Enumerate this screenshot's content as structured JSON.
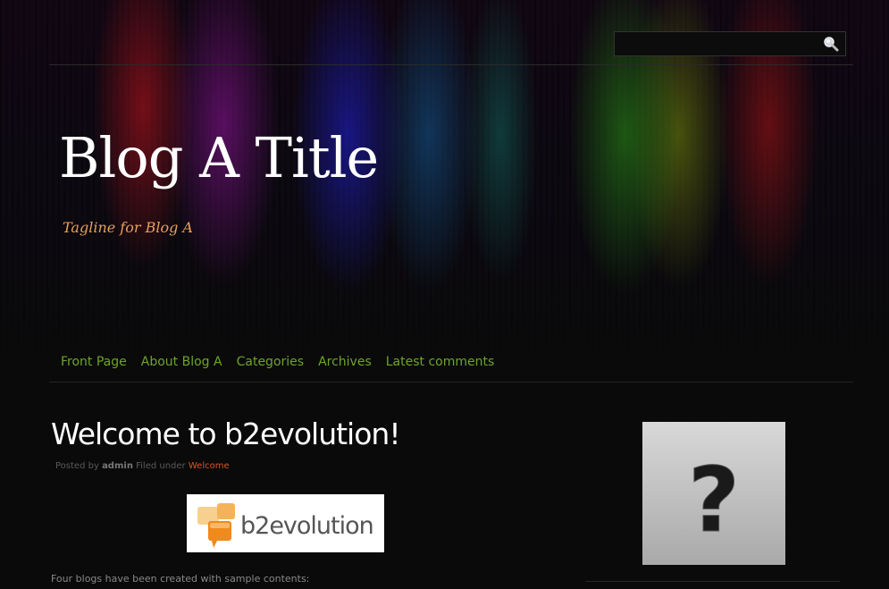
{
  "header": {
    "blog_title": "Blog A Title",
    "tagline": "Tagline for Blog A"
  },
  "search": {
    "placeholder": "",
    "value": "",
    "icon": "magnifier-icon"
  },
  "nav": {
    "items": [
      "Front Page",
      "About Blog A",
      "Categories",
      "Archives",
      "Latest comments"
    ],
    "link_color": "#6ca52a"
  },
  "post": {
    "title": "Welcome to b2evolution!",
    "meta": {
      "posted_by_label": "Posted by",
      "author": "admin",
      "filed_under_label": "Filed under",
      "category": "Welcome"
    },
    "logo_text": "b2evolution",
    "intro": "Four blogs have been created with sample contents:"
  },
  "sidebar": {
    "avatar_icon": "question-mark-icon"
  },
  "colors": {
    "background": "#0a0a0a",
    "tagline": "#e8a05a",
    "category_link": "#d35a1e"
  }
}
